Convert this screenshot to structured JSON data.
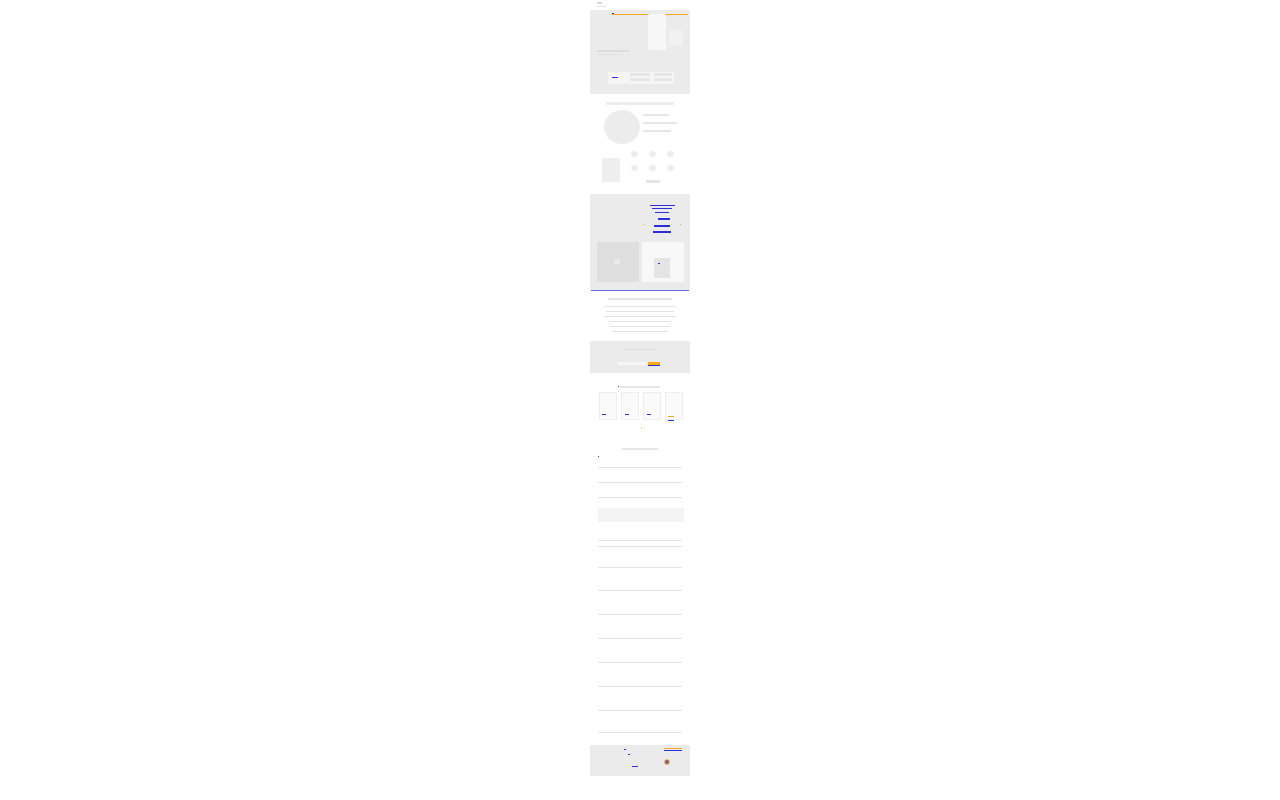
{
  "colors": {
    "accent": "#f7a81b",
    "link": "#2a2fd6",
    "panel": "#ebebeb",
    "page": "#ffffff"
  },
  "icons": [
    "logo-icon",
    "menu-icon",
    "phone-icon",
    "play-icon",
    "envelope-icon",
    "map-pin-icon"
  ]
}
